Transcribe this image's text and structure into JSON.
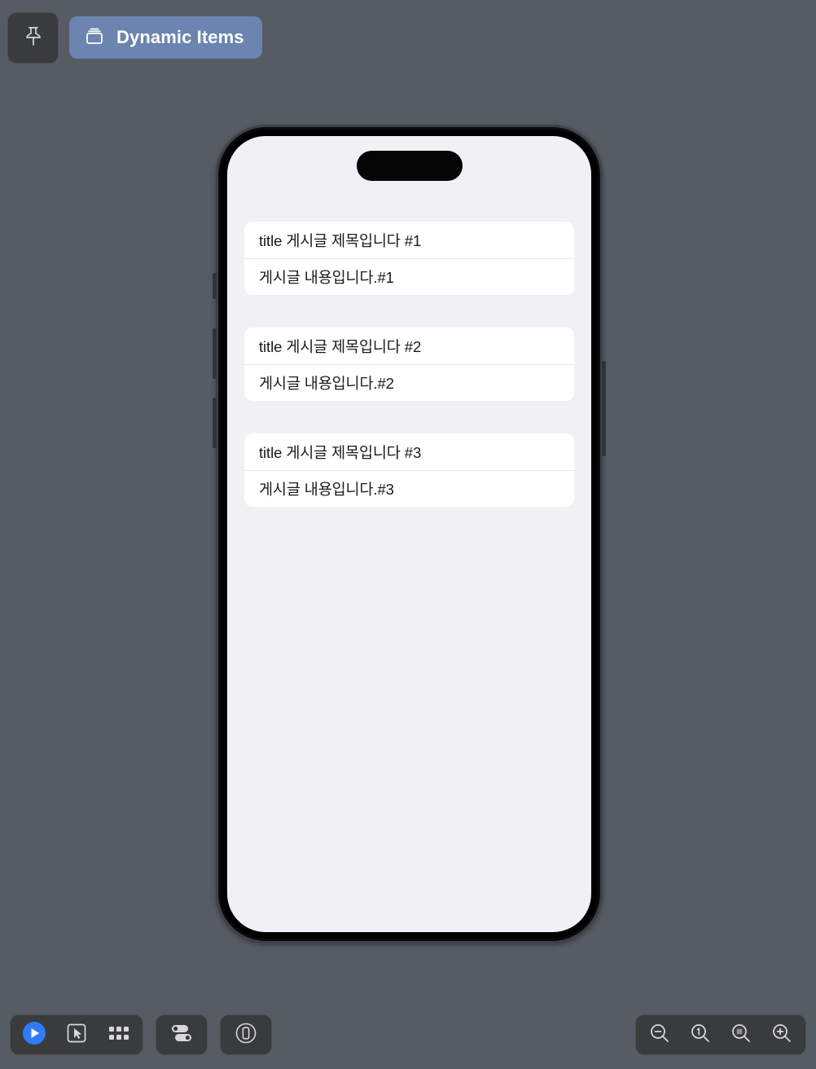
{
  "window": {
    "background_color": "#565B64"
  },
  "top_bar": {
    "pin_button": {
      "icon": "pushpin-icon",
      "label": ""
    },
    "tabs": [
      {
        "label": "Dynamic Items",
        "icon": "preview-canvas-icon",
        "selected": true,
        "accent_color": "#6B84B0"
      }
    ]
  },
  "preview": {
    "device": "iPhone",
    "screen_background": "#F1F0F5",
    "dynamic_island": true,
    "side_buttons": [
      "silent-switch",
      "volume-up-button",
      "volume-down-button",
      "power-button"
    ],
    "cards": [
      {
        "title": "title 게시글 제목입니다 #1",
        "body": "게시글 내용입니다.#1"
      },
      {
        "title": "title 게시글 제목입니다 #2",
        "body": "게시글 내용입니다.#2"
      },
      {
        "title": "title 게시글 제목입니다 #3",
        "body": "게시글 내용입니다.#3"
      }
    ]
  },
  "bottom_toolbar": {
    "left_groups": [
      {
        "buttons": [
          {
            "name": "play-preview-button",
            "icon": "play-circle-icon",
            "accent_color": "#2F7CF6"
          },
          {
            "name": "select-tool-button",
            "icon": "cursor-select-icon"
          },
          {
            "name": "variants-button",
            "icon": "grid-variants-icon"
          }
        ]
      },
      {
        "buttons": [
          {
            "name": "device-settings-button",
            "icon": "toggles-icon"
          }
        ]
      },
      {
        "buttons": [
          {
            "name": "device-orientation-button",
            "icon": "device-frame-icon"
          }
        ]
      }
    ],
    "zoom_controls": [
      {
        "name": "zoom-out-button",
        "icon": "magnifier-minus-icon"
      },
      {
        "name": "zoom-actual-size-button",
        "icon": "magnifier-one-icon",
        "label": "1"
      },
      {
        "name": "zoom-fit-button",
        "icon": "magnifier-fit-icon"
      },
      {
        "name": "zoom-in-button",
        "icon": "magnifier-plus-icon"
      }
    ]
  }
}
